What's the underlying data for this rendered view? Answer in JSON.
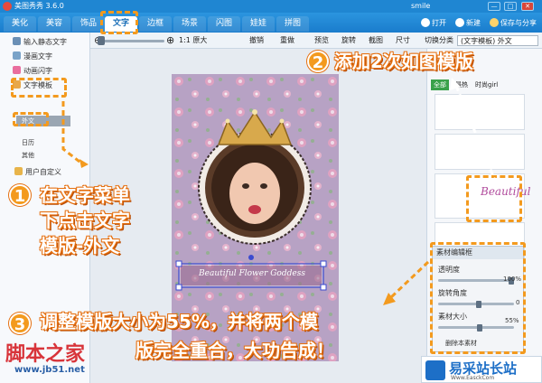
{
  "window": {
    "title": "美图秀秀 3.6.0",
    "user": "smile",
    "controls": [
      "—",
      "□",
      "✕"
    ]
  },
  "tabs": [
    {
      "label": "美化",
      "active": false
    },
    {
      "label": "美容",
      "active": false
    },
    {
      "label": "饰品",
      "active": false
    },
    {
      "label": "文字",
      "active": true
    },
    {
      "label": "边框",
      "active": false
    },
    {
      "label": "场景",
      "active": false
    },
    {
      "label": "闪图",
      "active": false
    },
    {
      "label": "娃娃",
      "active": false
    },
    {
      "label": "拼图",
      "active": false
    }
  ],
  "top_actions": {
    "open": "打开",
    "new": "新建",
    "save_share": "保存与分享"
  },
  "toolbar": {
    "zoom_in": "⊕",
    "zoom_out": "⊖",
    "actual_size": "1:1 原大",
    "undo": "撤销",
    "redo": "重做",
    "preview": "预览",
    "rotate": "旋转",
    "crop": "截图",
    "size": "尺寸",
    "switch_category_label": "切换分类",
    "switch_category_value": "(文字模板) 外文"
  },
  "left_menu": {
    "items": [
      {
        "label": "输入静态文字",
        "icon": "text-icon"
      },
      {
        "label": "漫画文字",
        "icon": "comic-text-icon"
      },
      {
        "label": "动画闪字",
        "icon": "animated-text-icon"
      },
      {
        "label": "文字模板",
        "icon": "template-icon"
      }
    ],
    "sub_items": [
      {
        "label": "外文",
        "selected": true
      },
      {
        "label": "日历",
        "selected": false
      },
      {
        "label": "其他",
        "selected": false
      }
    ],
    "user_custom": "用户自定义"
  },
  "right_panel": {
    "tabs": [
      "全部",
      "最热",
      "时尚girl"
    ],
    "thumb_text": "Beautiful"
  },
  "material_editor": {
    "title": "素材编辑框",
    "opacity_label": "透明度",
    "opacity_value": "100%",
    "opacity": 1.0,
    "rotate_label": "旋转角度",
    "rotate_value": "0",
    "size_label": "素材大小",
    "size_value": "55%",
    "size": 0.55,
    "extra_buttons": [
      "删除本素材"
    ]
  },
  "poster": {
    "banner_text": "Beautiful Flower Goddess"
  },
  "annotations": {
    "step1_num": "1",
    "step1_lines": [
      "在文字菜单",
      "下点击文字",
      "模版-外文"
    ],
    "step2_num": "2",
    "step2_text": "添加2次如图模版",
    "step3_num": "3",
    "step3_line1": "调整模版大小为55%，并将两个模",
    "step3_line2": "版完全重合，大功告成！"
  },
  "watermarks": {
    "left_cn": "脚本之家",
    "left_url": "www.jb51.net",
    "right_cn": "易采站长站",
    "right_sub": "Www.EasckCom"
  },
  "colors": {
    "titlebar": "#1f86d2",
    "accent_orange": "#f39a1e",
    "poster_bg": "#b7a2c4"
  }
}
